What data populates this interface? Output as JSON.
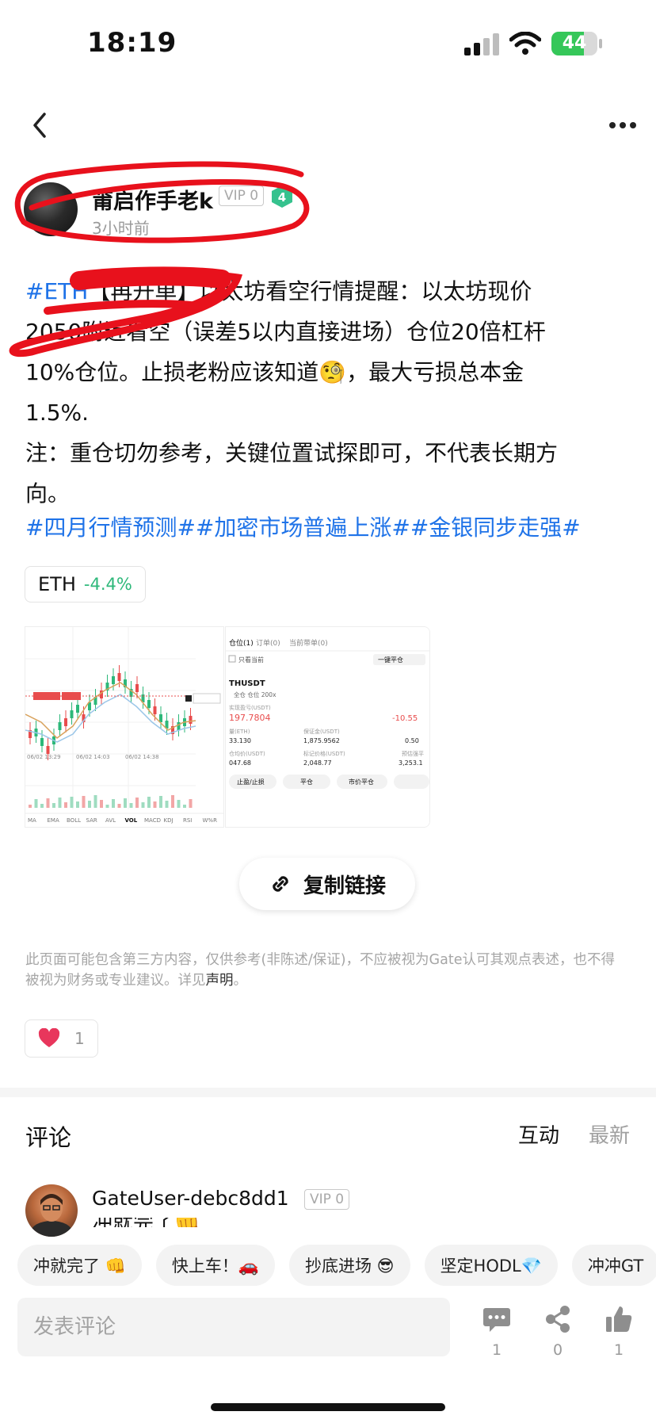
{
  "status_bar": {
    "time": "18:19",
    "battery": "44"
  },
  "post": {
    "author": {
      "name": "莆启作手老k",
      "vip": "VIP 0",
      "level": "4",
      "time_ago": "3小时前"
    },
    "lines": [
      {
        "hashtag": "#ETH",
        "text": "【再开单】以太坊看空行情提醒：以太坊现价"
      },
      {
        "text": "2050附近看空（误差5以内直接进场）仓位20倍杠杆"
      },
      {
        "text": "10%仓位。止损老粉应该知道🧐，最大亏损总本金"
      },
      {
        "text": "1.5%."
      },
      {
        "text": "注：重仓切勿参考，关键位置试探即可，不代表长期方"
      },
      {
        "text": "向。"
      }
    ],
    "tags": "#四月行情预测##加密市场普遍上涨##金银同步走强#",
    "ticker": {
      "symbol": "ETH",
      "change": "-4.4%"
    },
    "copy_link": "复制链接",
    "disclaimer": {
      "text": "此页面可能包含第三方内容，仅供参考(非陈述/保证)，不应被视为Gate认可其观点表述，也不得被视为财务或专业建议。详见",
      "link": "声明",
      "end": "。"
    },
    "likes": "1"
  },
  "screenshot2": {
    "tabs": [
      "仓位(1)",
      "订单(0)",
      "当前带单(0)"
    ],
    "only_current": "只看当前",
    "close_all": "一键平仓",
    "symbol": "THUSDT",
    "mode": "全仓 仓位  200x",
    "pnl_label": "实现盈亏(USDT)",
    "pnl": "197.7804",
    "roe": "-10.55",
    "qty_label": "量(ETH)",
    "qty": "33.130",
    "margin_label": "保证金(USDT)",
    "margin": "1,875.9562",
    "ratio": "0.50",
    "entry_label": "仓均价(USDT)",
    "entry": "047.68",
    "mark_label": "标记价格(USDT)",
    "mark": "2,048.77",
    "liq_label": "预估强平",
    "liq": "3,253.1",
    "btns": [
      "止盈/止损",
      "平仓",
      "市价平仓"
    ]
  },
  "screenshot1": {
    "dates": [
      "06/02 13:29",
      "06/02 14:03",
      "06/02 14:38"
    ],
    "indicators": [
      "MA",
      "EMA",
      "BOLL",
      "SAR",
      "AVL",
      "VOL",
      "MACD",
      "KDJ",
      "RSI",
      "W%R"
    ]
  },
  "comments": {
    "title": "评论",
    "sort_hot": "互动",
    "sort_new": "最新",
    "items": [
      {
        "name": "GateUser-debc8dd1",
        "vip": "VIP 0",
        "text": "冲就完了👊"
      }
    ]
  },
  "quick_replies": [
    "冲就完了 👊",
    "快上车！🚗",
    "抄底进场 😎",
    "坚定HODL💎",
    "冲冲GT"
  ],
  "input": {
    "placeholder": "发表评论"
  },
  "actions": {
    "comments": "1",
    "shares": "0",
    "likes": "1"
  },
  "colors": {
    "link": "#1f73e8",
    "positive": "#2db87a",
    "negative": "#e84c4c",
    "annotation": "#e8111c",
    "badge": "#36c28e"
  },
  "icons": [
    "back-icon",
    "more-icon",
    "link-icon",
    "heart-icon",
    "comment-icon",
    "share-icon",
    "thumbs-up-icon"
  ]
}
